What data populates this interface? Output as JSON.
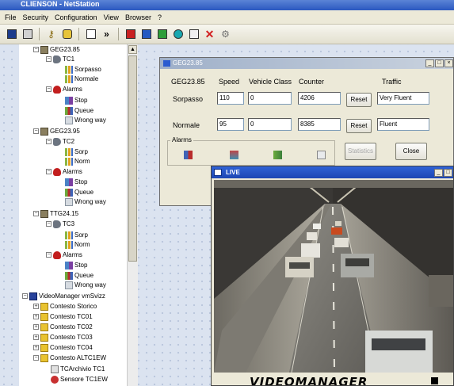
{
  "app": {
    "title": "CLIENSON - NetStation"
  },
  "menu": [
    "File",
    "Security",
    "Configuration",
    "View",
    "Browser",
    "?"
  ],
  "toolbar": {
    "buttons": [
      "save-icon",
      "print-icon",
      "key-icon",
      "lock-icon",
      "window-icon",
      "more-icon",
      "red-book-icon",
      "blue-book-icon",
      "green-book-icon",
      "info-icon",
      "report-icon",
      "close-red-icon",
      "network-icon"
    ],
    "more_label": "»"
  },
  "tree": {
    "items": [
      {
        "text": "GEG23.85",
        "icon": "device-icon"
      },
      {
        "text": "TC1",
        "icon": "camera-icon"
      },
      {
        "text": "Sorpasso",
        "icon": "lane-icon"
      },
      {
        "text": "Normale",
        "icon": "lane-icon"
      },
      {
        "text": "Alarms",
        "icon": "alarm-icon"
      },
      {
        "text": "Stop",
        "icon": "stop-alarm-icon"
      },
      {
        "text": "Queue",
        "icon": "queue-alarm-icon"
      },
      {
        "text": "Wrong way",
        "icon": "wrong-way-icon"
      },
      {
        "text": "GEG23.95",
        "icon": "device-icon"
      },
      {
        "text": "TC2",
        "icon": "camera-icon"
      },
      {
        "text": "Sorp",
        "icon": "lane-icon"
      },
      {
        "text": "Norm",
        "icon": "lane-icon"
      },
      {
        "text": "Alarms",
        "icon": "alarm-icon"
      },
      {
        "text": "Stop",
        "icon": "stop-alarm-icon"
      },
      {
        "text": "Queue",
        "icon": "queue-alarm-icon"
      },
      {
        "text": "Wrong way",
        "icon": "wrong-way-icon"
      },
      {
        "text": "TTG24.15",
        "icon": "device-icon"
      },
      {
        "text": "TC3",
        "icon": "camera-icon"
      },
      {
        "text": "Sorp",
        "icon": "lane-icon"
      },
      {
        "text": "Norm",
        "icon": "lane-icon"
      },
      {
        "text": "Alarms",
        "icon": "alarm-icon"
      },
      {
        "text": "Stop",
        "icon": "stop-alarm-icon"
      },
      {
        "text": "Queue",
        "icon": "queue-alarm-icon"
      },
      {
        "text": "Wrong way",
        "icon": "wrong-way-icon"
      },
      {
        "text": "VideoManager vmSvizz",
        "icon": "monitor-icon"
      },
      {
        "text": "Contesto Storico",
        "icon": "folder-icon"
      },
      {
        "text": "Contesto TC01",
        "icon": "folder-icon"
      },
      {
        "text": "Contesto TC02",
        "icon": "folder-icon"
      },
      {
        "text": "Contesto TC03",
        "icon": "folder-icon"
      },
      {
        "text": "Contesto TC04",
        "icon": "folder-icon"
      },
      {
        "text": "Contesto ALTC1EW",
        "icon": "folder-icon"
      },
      {
        "text": "TCArchivio TC1",
        "icon": "archive-camera-icon"
      },
      {
        "text": "Sensore TC1EW",
        "icon": "sensor-icon"
      }
    ]
  },
  "geg": {
    "title": "GEG23.85",
    "headers": {
      "name": "GEG23.85",
      "speed": "Speed",
      "vclass": "Vehicle Class",
      "counter": "Counter",
      "traffic": "Traffic"
    },
    "rows": [
      {
        "label": "Sorpasso",
        "speed": "110",
        "vclass": "0",
        "counter": "4206",
        "reset": "Reset",
        "traffic": "Very Fluent"
      },
      {
        "label": "Normale",
        "speed": "95",
        "vclass": "0",
        "counter": "8385",
        "reset": "Reset",
        "traffic": "Fluent"
      }
    ],
    "alarms_label": "Alarms",
    "statistics_label": "Statistics",
    "close_label": "Close",
    "window_buttons": [
      "_",
      "□",
      "×"
    ]
  },
  "live": {
    "title": "LIVE",
    "brand": "VIDEOMANAGER",
    "window_buttons": [
      "_",
      "□"
    ]
  }
}
